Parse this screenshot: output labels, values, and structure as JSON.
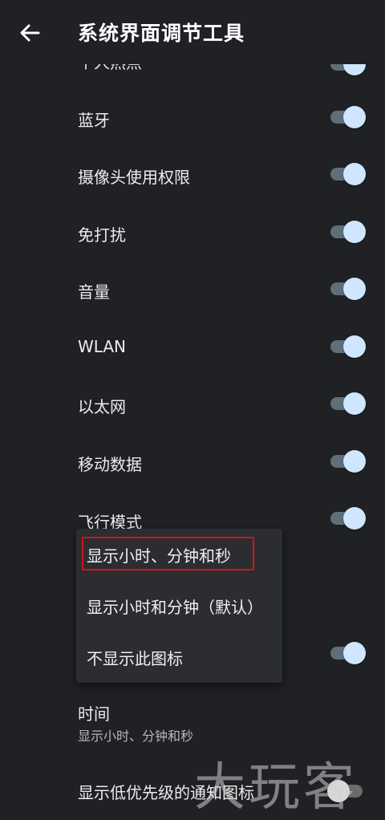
{
  "header": {
    "title": "系统界面调节工具",
    "back_icon": "arrow-left-icon"
  },
  "settings": {
    "items": [
      {
        "label": "个人热点",
        "on": true
      },
      {
        "label": "蓝牙",
        "on": true
      },
      {
        "label": "摄像头使用权限",
        "on": true
      },
      {
        "label": "免打扰",
        "on": true
      },
      {
        "label": "音量",
        "on": true
      },
      {
        "label": "WLAN",
        "on": true
      },
      {
        "label": "以太网",
        "on": true
      },
      {
        "label": "移动数据",
        "on": true
      },
      {
        "label": "飞行模式",
        "on": true
      }
    ],
    "hidden_row_on": true,
    "time": {
      "label": "时间",
      "summary": "显示小时、分钟和秒"
    },
    "low_priority": {
      "label": "显示低优先级的通知图标",
      "on": false
    }
  },
  "popup": {
    "options": [
      "显示小时、分钟和秒",
      "显示小时和分钟（默认）",
      "不显示此图标"
    ],
    "highlighted_index": 0
  },
  "colors": {
    "background": "#1f2124",
    "accent_thumb": "#cfe6ff",
    "highlight": "#d0141b"
  },
  "watermark": "大玩客"
}
